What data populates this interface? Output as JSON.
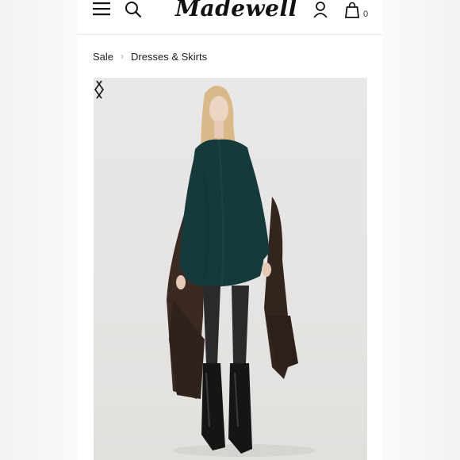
{
  "header": {
    "logo_text": "Madewell",
    "bag_count": "0",
    "icons": [
      "menu-icon",
      "search-icon",
      "account-icon",
      "bag-icon"
    ]
  },
  "breadcrumb": {
    "items": [
      "Sale",
      "Dresses & Skirts"
    ]
  },
  "product_image": {
    "description_icon": "product-photo",
    "colors": {
      "dress": "#163a3c",
      "coat": "#3a2a22",
      "background": "#e7e6e4"
    }
  },
  "carousel": {
    "prev_icon": "chevron-left-icon",
    "next_icon": "chevron-right-icon"
  }
}
